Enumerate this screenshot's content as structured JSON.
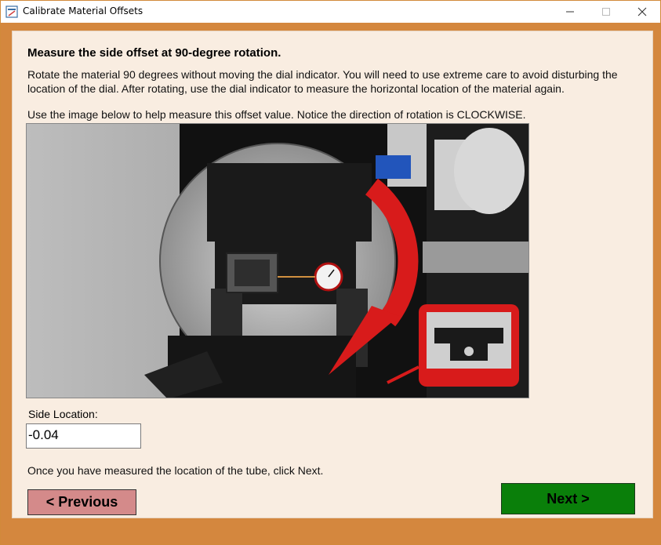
{
  "window": {
    "title": "Calibrate Material Offsets",
    "min_icon": "minimize-icon",
    "max_icon": "maximize-icon",
    "close_icon": "close-icon",
    "accent_color": "#d4873e",
    "client_background": "#f9ede1"
  },
  "content": {
    "heading": "Measure the side offset at 90-degree rotation.",
    "paragraph": "Rotate the material 90 degrees without moving the dial indicator. You will need to use extreme care to avoid disturbing the location of the dial. After rotating, use the dial indicator to measure the horizontal location of the material again.",
    "image_instruction": "Use the image below to help measure this offset value. Notice the direction of rotation is CLOCKWISE."
  },
  "form": {
    "side_location_label": "Side Location:",
    "side_location_value": "-0.04"
  },
  "footer": {
    "hint": "Once you have measured the location of the tube, click Next.",
    "previous_label": "< Previous",
    "previous_color": "#d48a8a",
    "next_label": "Next >",
    "next_color": "#0a7f0a"
  }
}
